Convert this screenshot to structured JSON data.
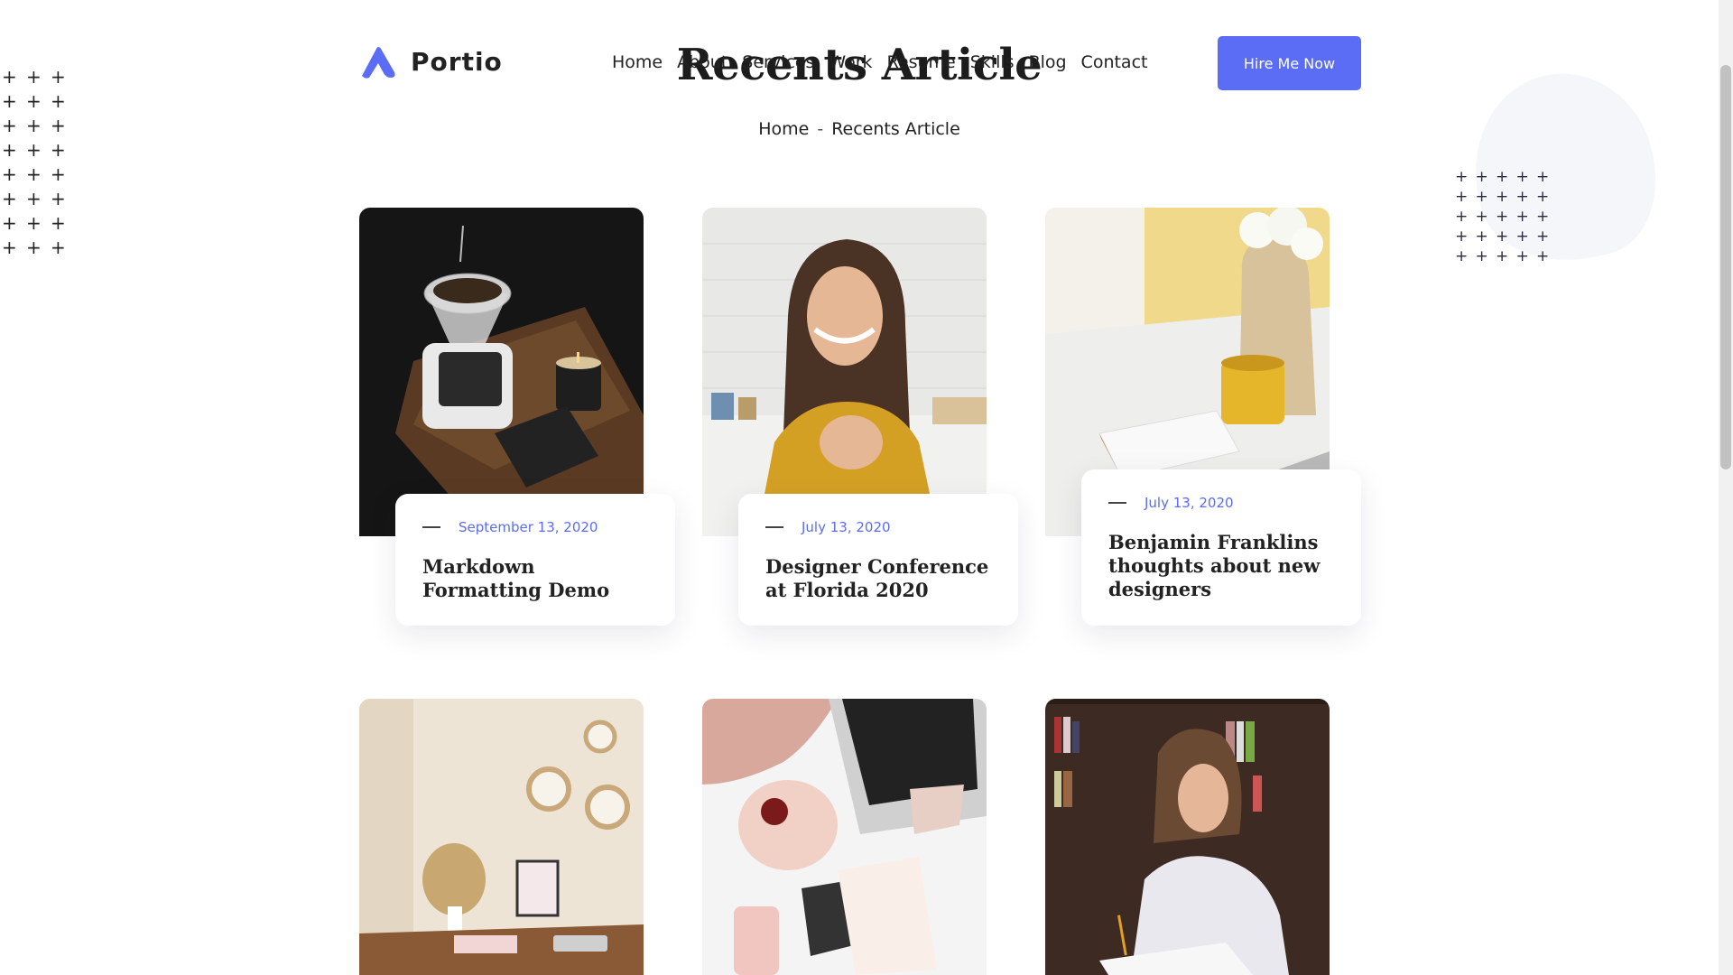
{
  "brand": {
    "name": "Portio",
    "accent": "#5b6cf5"
  },
  "nav": {
    "items": [
      "Home",
      "About",
      "Services",
      "Work",
      "Resume",
      "Skills",
      "Blog",
      "Contact"
    ]
  },
  "header": {
    "cta_label": "Hire Me Now"
  },
  "hero": {
    "title": "Recents Article"
  },
  "breadcrumb": {
    "home": "Home",
    "separator": "-",
    "current": "Recents Article"
  },
  "articles": [
    {
      "date": "September 13, 2020",
      "title": "Markdown Formatting Demo",
      "image": "coffee-dripper-photo"
    },
    {
      "date": "July 13, 2020",
      "title": "Designer Conference at Florida 2020",
      "image": "smiling-woman-photo"
    },
    {
      "date": "July 13, 2020",
      "title": "Benjamin Franklins thoughts about new designers",
      "image": "desk-mug-flowers-photo"
    },
    {
      "image": "wall-mirrors-desk-photo"
    },
    {
      "image": "flatlay-laptop-photo"
    },
    {
      "image": "woman-writing-photo"
    }
  ],
  "decor": {
    "plus_glyph": "+"
  }
}
